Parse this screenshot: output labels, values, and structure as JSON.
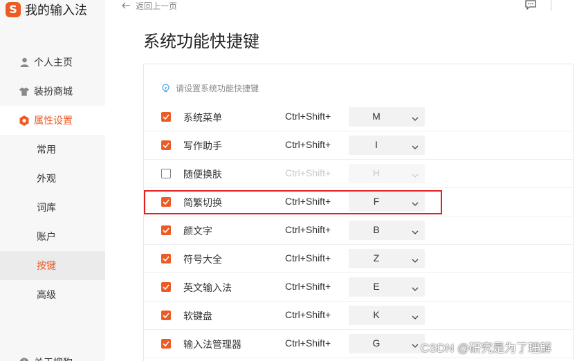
{
  "app": {
    "title": "我的输入法",
    "logo_text": "S"
  },
  "sidebar": {
    "main": [
      {
        "label": "个人主页",
        "icon": "user-icon"
      },
      {
        "label": "装扮商城",
        "icon": "shirt-icon"
      },
      {
        "label": "属性设置",
        "icon": "hexagon-settings-icon",
        "active": true
      }
    ],
    "sub": [
      {
        "label": "常用"
      },
      {
        "label": "外观"
      },
      {
        "label": "词库"
      },
      {
        "label": "账户"
      },
      {
        "label": "按键",
        "active": true
      },
      {
        "label": "高级"
      }
    ],
    "footer_item": {
      "label": "关于搜狗",
      "icon": "info-icon"
    }
  },
  "topbar": {
    "back_label": "返回上一页",
    "feedback_icon": "message-icon"
  },
  "page": {
    "title": "系统功能快捷键",
    "hint": "请设置系统功能快捷键"
  },
  "shortcuts": [
    {
      "label": "系统菜单",
      "combo": "Ctrl+Shift+",
      "key": "M",
      "checked": true
    },
    {
      "label": "写作助手",
      "combo": "Ctrl+Shift+",
      "key": "I",
      "checked": true
    },
    {
      "label": "随便换肤",
      "combo": "Ctrl+Shift+",
      "key": "H",
      "checked": false
    },
    {
      "label": "简繁切换",
      "combo": "Ctrl+Shift+",
      "key": "F",
      "checked": true
    },
    {
      "label": "颜文字",
      "combo": "Ctrl+Shift+",
      "key": "B",
      "checked": true
    },
    {
      "label": "符号大全",
      "combo": "Ctrl+Shift+",
      "key": "Z",
      "checked": true
    },
    {
      "label": "英文输入法",
      "combo": "Ctrl+Shift+",
      "key": "E",
      "checked": true
    },
    {
      "label": "软键盘",
      "combo": "Ctrl+Shift+",
      "key": "K",
      "checked": true
    },
    {
      "label": "输入法管理器",
      "combo": "Ctrl+Shift+",
      "key": "G",
      "checked": true
    }
  ],
  "watermark": "CSDN @研究是为了理解",
  "colors": {
    "accent": "#ee5a24",
    "highlight_border": "#e02020",
    "sidebar_bg": "#f7f7f7"
  }
}
